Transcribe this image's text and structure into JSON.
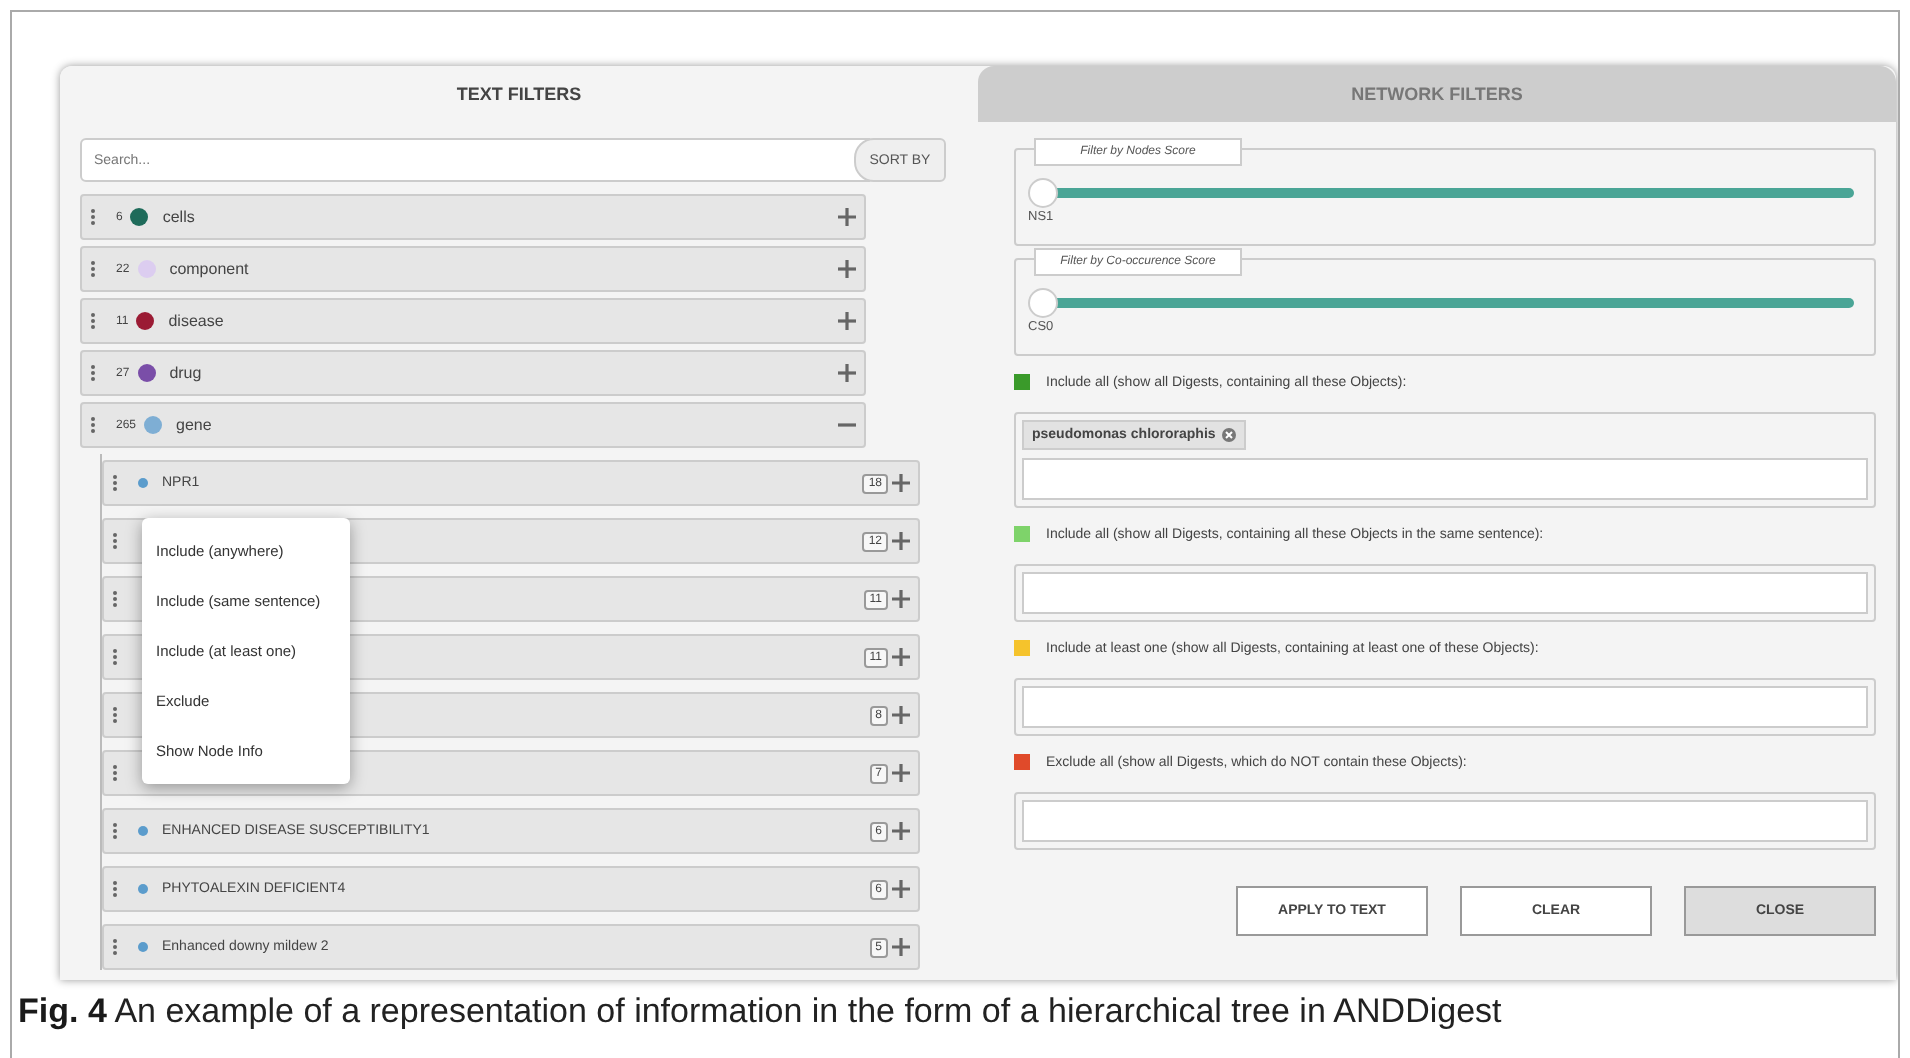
{
  "tabs": [
    {
      "label": "TEXT FILTERS",
      "selected": true
    },
    {
      "label": "NETWORK FILTERS",
      "selected": false
    }
  ],
  "search": {
    "placeholder": "Search..."
  },
  "sort_button": "SORT BY",
  "categories": [
    {
      "count": "6",
      "color": "#1e6b5a",
      "label": "cells",
      "expanded": false
    },
    {
      "count": "22",
      "color": "#dccdf0",
      "label": "component",
      "expanded": false
    },
    {
      "count": "11",
      "color": "#9b1b34",
      "label": "disease",
      "expanded": false
    },
    {
      "count": "27",
      "color": "#7a4ea8",
      "label": "drug",
      "expanded": false
    },
    {
      "count": "265",
      "color": "#7eaed4",
      "label": "gene",
      "expanded": true,
      "children": [
        {
          "label": "NPR1",
          "count": "18",
          "color": "#5b9ccc"
        },
        {
          "count": "12"
        },
        {
          "count": "11"
        },
        {
          "count": "11"
        },
        {
          "count": "8"
        },
        {
          "count": "7"
        },
        {
          "label": "ENHANCED DISEASE SUSCEPTIBILITY1",
          "count": "6",
          "color": "#5b9ccc"
        },
        {
          "label": "PHYTOALEXIN DEFICIENT4",
          "count": "6",
          "color": "#5b9ccc"
        },
        {
          "label": "Enhanced downy mildew 2",
          "count": "5",
          "color": "#5b9ccc"
        }
      ]
    }
  ],
  "context_menu": [
    "Include (anywhere)",
    "Include (same sentence)",
    "Include (at least one)",
    "Exclude",
    "Show Node Info"
  ],
  "sliders": [
    {
      "legend": "Filter by Nodes Score",
      "level": 0,
      "reading": "NS1"
    },
    {
      "legend": "Filter by Co-occurence Score",
      "level": 0,
      "reading": "CS0"
    }
  ],
  "groups": [
    {
      "color": "#3a9a2a",
      "label": "Include all (show all Digests, containing all these Objects):",
      "chips": [
        "pseudomonas chlororaphis"
      ]
    },
    {
      "color": "#7ed36a",
      "label": "Include all (show all Digests, containing all these Objects in the same sentence):"
    },
    {
      "color": "#f5c32c",
      "label": "Include at least one (show all Digests, containing at least one of these Objects):"
    },
    {
      "color": "#e04a2a",
      "label": "Exclude all (show all Digests, which do NOT contain these Objects):"
    }
  ],
  "buttons": [
    {
      "label": "APPLY TO TEXT",
      "highlighted": false
    },
    {
      "label": "CLEAR",
      "highlighted": false
    },
    {
      "label": "CLOSE",
      "highlighted": true
    }
  ],
  "caption": "**Fig. 4** An example of a representation of information in the form of a hierarchical tree in ANDDigest"
}
